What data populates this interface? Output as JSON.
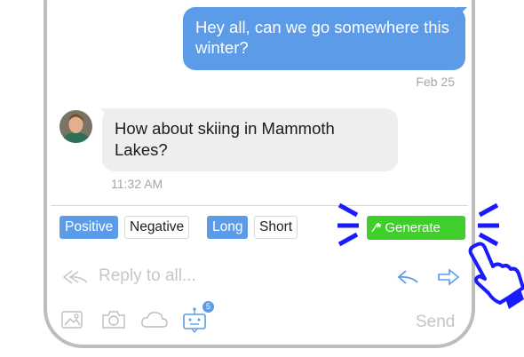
{
  "thread": {
    "outgoing": {
      "text": "Hey all, can we go somewhere this winter?",
      "date": "Feb 25"
    },
    "incoming": {
      "text": "How about skiing in Mammoth Lakes?",
      "time": "11:32 AM"
    }
  },
  "tone_chips": {
    "positive": "Positive",
    "negative": "Negative",
    "long": "Long",
    "short": "Short"
  },
  "generate_label": "Generate",
  "composer": {
    "placeholder": "Reply to all...",
    "send_label": "Send"
  },
  "attach_badge": "5",
  "colors": {
    "accent": "#5b9be8",
    "generate": "#3fcf2a",
    "highlight": "#1a1aff"
  }
}
